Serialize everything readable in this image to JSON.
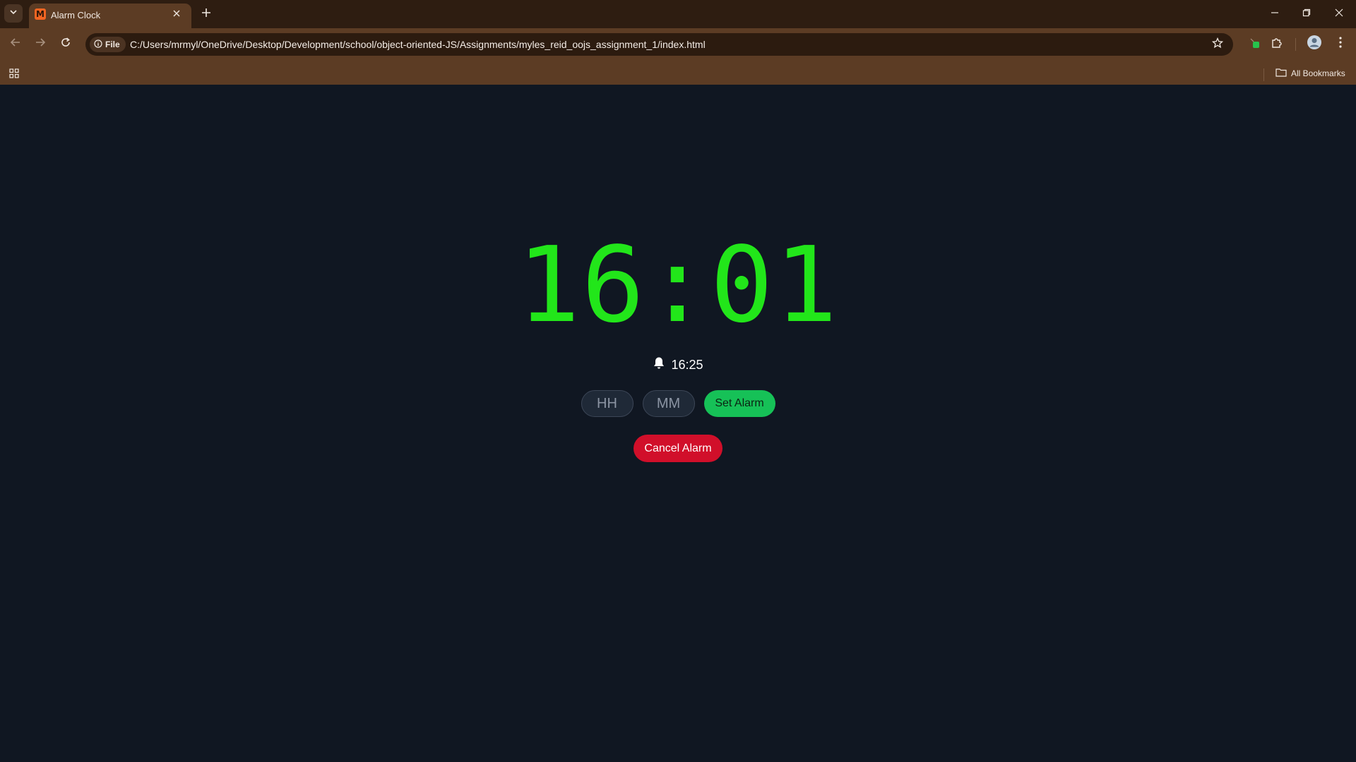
{
  "browser": {
    "tab": {
      "title": "Alarm Clock",
      "favicon_letter": "M"
    },
    "address": {
      "chip_label": "File",
      "url": "C:/Users/mrmyl/OneDrive/Desktop/Development/school/object-oriented-JS/Assignments/myles_reid_oojs_assignment_1/index.html"
    },
    "bookmarks": {
      "all_label": "All Bookmarks"
    }
  },
  "clock": {
    "time": "16:01",
    "color": "#22e61a"
  },
  "alarm": {
    "set_time": "16:25",
    "hour_placeholder": "HH",
    "minute_placeholder": "MM",
    "set_label": "Set Alarm",
    "cancel_label": "Cancel Alarm"
  },
  "colors": {
    "page_bg": "#101722",
    "set_button": "#16c157",
    "cancel_button": "#d10f2a",
    "chrome": "#5c3c24"
  }
}
